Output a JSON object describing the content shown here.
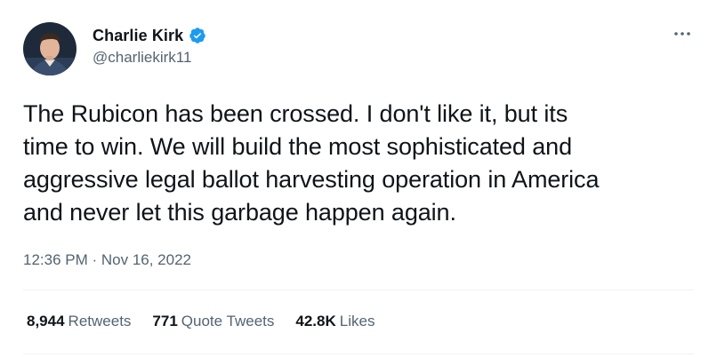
{
  "user": {
    "display_name": "Charlie Kirk",
    "handle": "@charliekirk11",
    "verified_icon": "verified-badge-icon"
  },
  "more_icon": "more-dots-icon",
  "tweet": {
    "lines": [
      "The Rubicon has been crossed. I don't like it, but its",
      "time to win. We will build the most sophisticated and",
      "aggressive legal ballot harvesting operation in America",
      "and never let this garbage happen again."
    ],
    "timestamp": "12:36 PM · Nov 16, 2022"
  },
  "stats": {
    "retweets_count": "8,944",
    "retweets_label": "Retweets",
    "quotes_count": "771",
    "quotes_label": "Quote Tweets",
    "likes_count": "42.8K",
    "likes_label": "Likes"
  },
  "colors": {
    "text_primary": "#0f1419",
    "text_secondary": "#536471",
    "verified_blue": "#1d9bf0",
    "divider": "#eff3f4"
  }
}
